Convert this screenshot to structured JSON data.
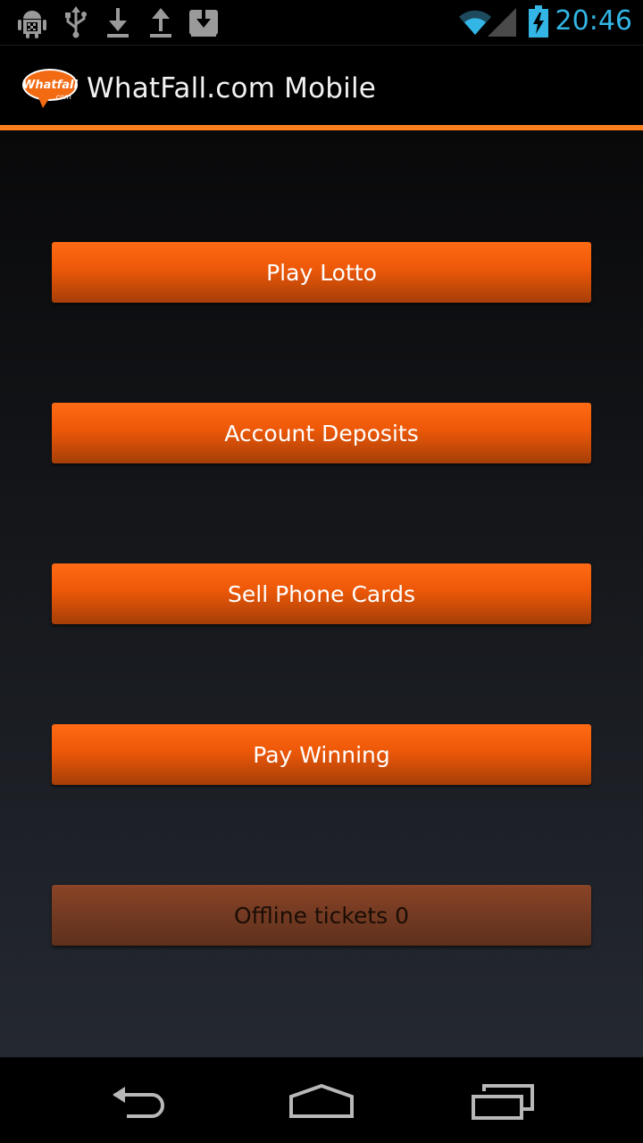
{
  "status_bar": {
    "time": "20:46",
    "icons": [
      "android-debug-icon",
      "usb-icon",
      "download-icon",
      "upload-icon",
      "download-box-icon",
      "wifi-icon",
      "signal-icon",
      "battery-charging-icon"
    ]
  },
  "action_bar": {
    "logo_text": "Whatfall",
    "logo_subtext": ".com",
    "title": "WhatFall.com Mobile"
  },
  "menu": {
    "play_lotto": "Play Lotto",
    "account_deposits": "Account Deposits",
    "sell_phone_cards": "Sell Phone Cards",
    "pay_winning": "Pay Winning",
    "offline_tickets": "Offline tickets 0"
  },
  "colors": {
    "accent": "#ff7f1f",
    "button": "#ec5808",
    "button_disabled": "#733a22",
    "clock": "#33b5e5"
  },
  "nav_bar": {
    "icons": [
      "back-icon",
      "home-icon",
      "recent-apps-icon"
    ]
  }
}
